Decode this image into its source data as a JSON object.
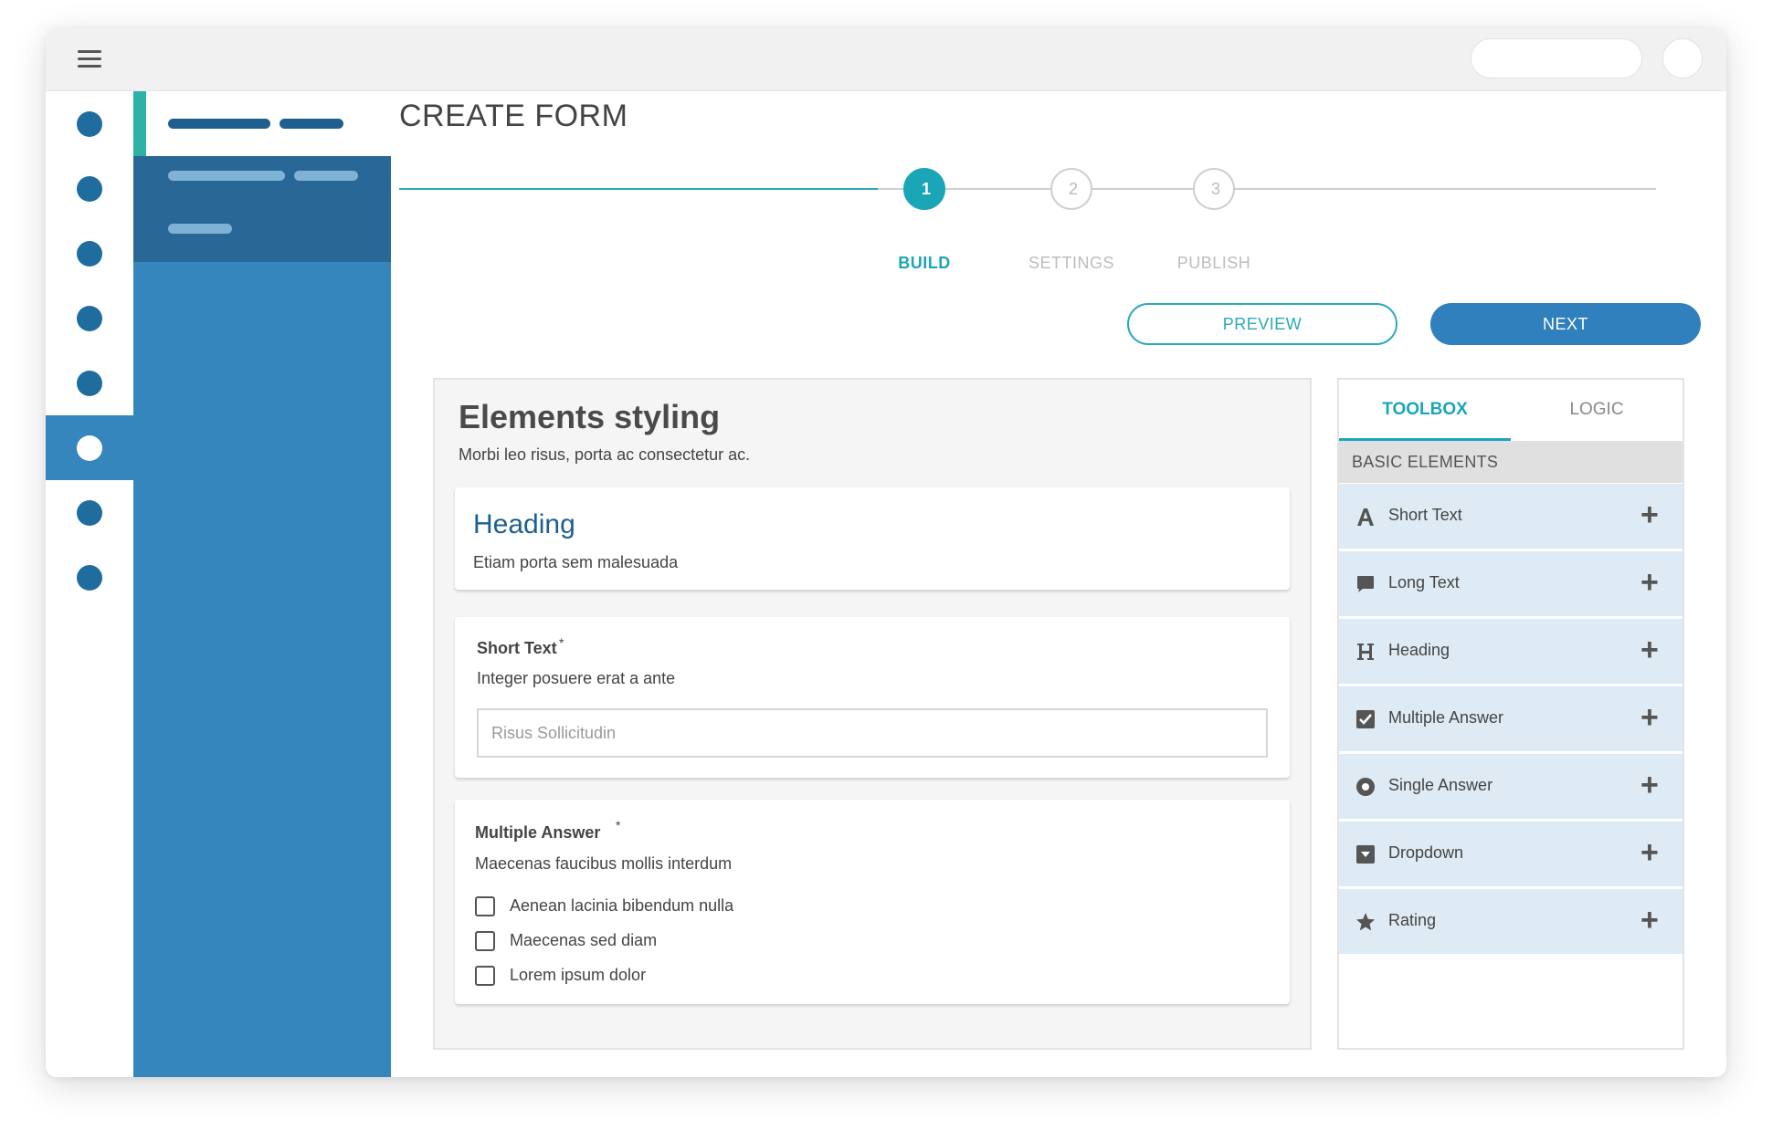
{
  "page": {
    "title": "CREATE FORM"
  },
  "stepper": {
    "steps": [
      {
        "number": "1",
        "label": "BUILD",
        "state": "active"
      },
      {
        "number": "2",
        "label": "SETTINGS",
        "state": "todo"
      },
      {
        "number": "3",
        "label": "PUBLISH",
        "state": "todo"
      }
    ]
  },
  "actions": {
    "preview_label": "PREVIEW",
    "next_label": "NEXT"
  },
  "form": {
    "title": "Elements styling",
    "description": "Morbi leo risus, porta ac consectetur ac.",
    "heading_card": {
      "title": "Heading",
      "subtitle": "Etiam porta sem malesuada"
    },
    "short_text": {
      "label": "Short Text",
      "required_mark": "*",
      "description": "Integer posuere erat a ante",
      "placeholder": "Risus Sollicitudin"
    },
    "multiple_answer": {
      "label": "Multiple Answer",
      "required_mark": "*",
      "description": "Maecenas faucibus mollis interdum",
      "options": [
        "Aenean lacinia bibendum nulla",
        "Maecenas sed diam",
        "Lorem ipsum dolor"
      ]
    }
  },
  "toolbox": {
    "tabs": [
      "TOOLBOX",
      "LOGIC"
    ],
    "section": "BASIC ELEMENTS",
    "items": [
      {
        "label": "Short Text",
        "icon": "letter-a-icon"
      },
      {
        "label": "Long Text",
        "icon": "speech-bubble-icon"
      },
      {
        "label": "Heading",
        "icon": "letter-h-icon"
      },
      {
        "label": "Multiple Answer",
        "icon": "checked-box-icon"
      },
      {
        "label": "Single Answer",
        "icon": "radio-icon"
      },
      {
        "label": "Dropdown",
        "icon": "dropdown-box-icon"
      },
      {
        "label": "Rating",
        "icon": "star-icon"
      }
    ],
    "add_symbol": "+"
  },
  "colors": {
    "accent_teal": "#1aa6b7",
    "primary_blue": "#2f80bd",
    "sidebar_blue": "#3586bd",
    "heading_blue": "#1d5f8e"
  }
}
